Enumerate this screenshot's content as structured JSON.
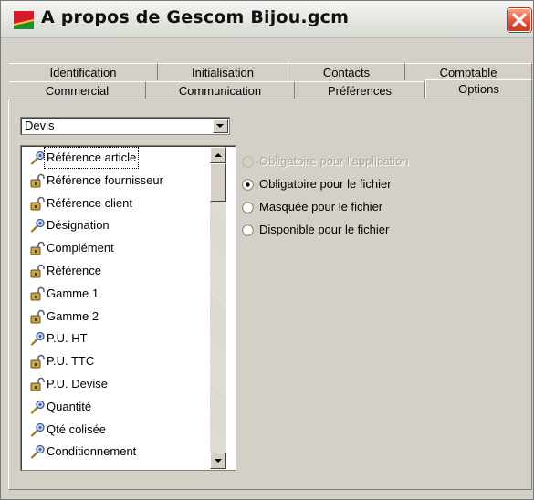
{
  "window": {
    "title": "A propos de Gescom Bijou.gcm",
    "colors": {
      "titlebar": "#e6e6e2",
      "face": "#d4d0c8",
      "close": "#e5533a"
    }
  },
  "tabs_row1": [
    {
      "label": "Identification"
    },
    {
      "label": "Initialisation"
    },
    {
      "label": "Contacts"
    },
    {
      "label": "Comptable"
    }
  ],
  "tabs_row2": [
    {
      "label": "Commercial"
    },
    {
      "label": "Communication"
    },
    {
      "label": "Préférences"
    },
    {
      "label": "Options",
      "active": true
    }
  ],
  "combo": {
    "value": "Devis"
  },
  "list": {
    "items": [
      {
        "label": "Référence article",
        "icon": "search-key-icon",
        "selected": true
      },
      {
        "label": "Référence fournisseur",
        "icon": "lock-icon"
      },
      {
        "label": "Référence client",
        "icon": "lock-icon"
      },
      {
        "label": "Désignation",
        "icon": "search-key-icon"
      },
      {
        "label": "Complément",
        "icon": "lock-icon"
      },
      {
        "label": "Référence",
        "icon": "lock-icon"
      },
      {
        "label": "Gamme 1",
        "icon": "lock-icon"
      },
      {
        "label": "Gamme 2",
        "icon": "lock-icon"
      },
      {
        "label": "P.U. HT",
        "icon": "search-key-icon"
      },
      {
        "label": "P.U. TTC",
        "icon": "lock-icon"
      },
      {
        "label": "P.U. Devise",
        "icon": "lock-icon"
      },
      {
        "label": "Quantité",
        "icon": "search-key-icon"
      },
      {
        "label": "Qté colisée",
        "icon": "search-key-icon"
      },
      {
        "label": "Conditionnement",
        "icon": "search-key-icon"
      }
    ]
  },
  "options": [
    {
      "label": "Obligatoire pour l'application",
      "disabled": true,
      "checked": false
    },
    {
      "label": "Obligatoire pour le fichier",
      "disabled": false,
      "checked": true
    },
    {
      "label": "Masquée pour le fichier",
      "disabled": false,
      "checked": false
    },
    {
      "label": "Disponible pour le fichier",
      "disabled": false,
      "checked": false
    }
  ]
}
